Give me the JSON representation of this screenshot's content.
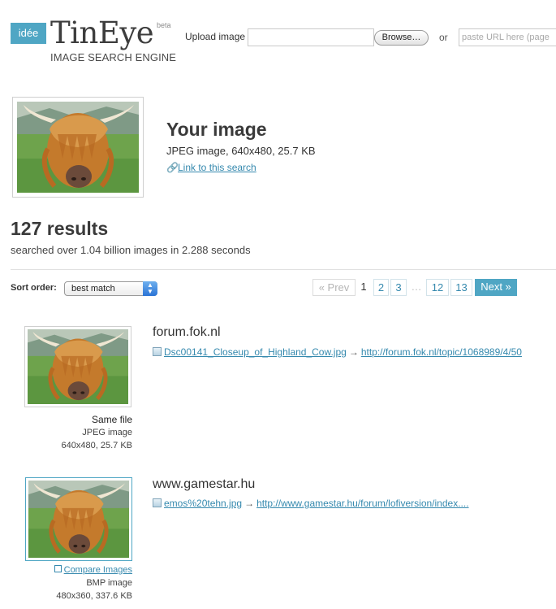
{
  "header": {
    "idee_label": "idée",
    "logo_title": "TinEye",
    "logo_beta": "beta",
    "logo_subtitle": "IMAGE SEARCH ENGINE",
    "upload_label": "Upload image",
    "browse_label": "Browse…",
    "or_label": "or",
    "url_placeholder": "paste URL here (page"
  },
  "your_image": {
    "title": "Your image",
    "meta": "JPEG image, 640x480, 25.7 KB",
    "link_label": "Link to this search"
  },
  "results": {
    "count_label": "127 results",
    "summary": "searched over 1.04 billion images in 2.288 seconds",
    "sort_label": "Sort order:",
    "sort_value": "best match"
  },
  "pagination": {
    "prev": "« Prev",
    "current": "1",
    "p2": "2",
    "p3": "3",
    "ellipsis": "…",
    "p12": "12",
    "p13": "13",
    "next": "Next »"
  },
  "items": [
    {
      "domain": "forum.fok.nl",
      "file": "Dsc00141_Closeup_of_Highland_Cow.jpg",
      "arrow": "→",
      "page": "http://forum.fok.nl/topic/1068989/4/50",
      "caption": "Same file",
      "format": "JPEG image",
      "size": "640x480, 25.7 KB"
    },
    {
      "domain": "www.gamestar.hu",
      "file": "emos%20tehn.jpg",
      "arrow": "→",
      "page": "http://www.gamestar.hu/forum/lofiversion/index....",
      "caption": "Compare Images",
      "format": "BMP image",
      "size": "480x360, 337.6 KB"
    }
  ],
  "colors": {
    "accent": "#4fa6c4",
    "link": "#3589ae"
  }
}
